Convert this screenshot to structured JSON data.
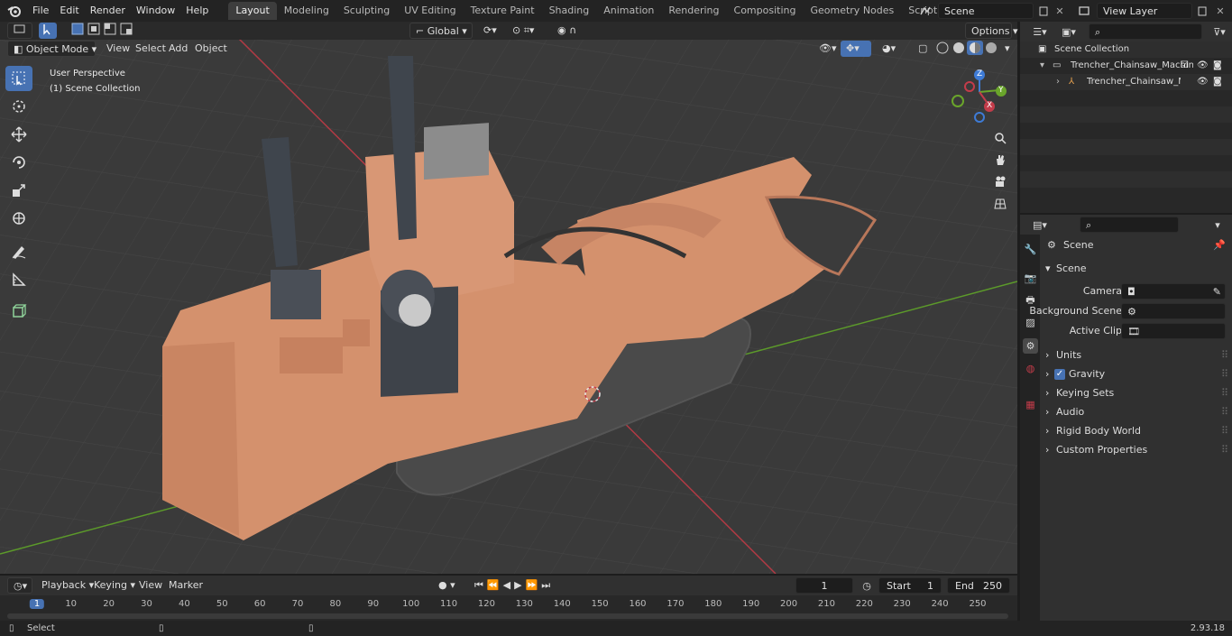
{
  "menu": [
    "File",
    "Edit",
    "Render",
    "Window",
    "Help"
  ],
  "workspaces": [
    "Layout",
    "Modeling",
    "Sculpting",
    "UV Editing",
    "Texture Paint",
    "Shading",
    "Animation",
    "Rendering",
    "Compositing",
    "Geometry Nodes",
    "Scripting"
  ],
  "active_workspace": "Layout",
  "scene_field": "Scene",
  "view_layer_field": "View Layer",
  "viewport": {
    "mode": "Object Mode",
    "menus": [
      "View",
      "Select",
      "Add",
      "Object"
    ],
    "transform_orientation": "Global",
    "options_label": "Options",
    "perspective_label": "User Perspective",
    "collection_label": "(1) Scene Collection"
  },
  "gizmo": {
    "x": "X",
    "y": "Y",
    "z": "Z"
  },
  "outliner": {
    "root": "Scene Collection",
    "items": [
      {
        "label": "Trencher_Chainsaw_Machine_"
      },
      {
        "label": "Trencher_Chainsaw_Mac"
      }
    ]
  },
  "properties": {
    "breadcrumb": "Scene",
    "section": "Scene",
    "fields": [
      {
        "label": "Camera"
      },
      {
        "label": "Background Scene"
      },
      {
        "label": "Active Clip"
      }
    ],
    "panels": [
      "Units",
      "Gravity",
      "Keying Sets",
      "Audio",
      "Rigid Body World",
      "Custom Properties"
    ]
  },
  "timeline": {
    "menus": [
      "Playback",
      "Keying",
      "View",
      "Marker"
    ],
    "current_frame": "1",
    "start_label": "Start",
    "start": "1",
    "end_label": "End",
    "end": "250",
    "ruler": [
      "1",
      "10",
      "20",
      "30",
      "40",
      "50",
      "60",
      "70",
      "80",
      "90",
      "100",
      "110",
      "120",
      "130",
      "140",
      "150",
      "160",
      "170",
      "180",
      "190",
      "200",
      "210",
      "220",
      "230",
      "240",
      "250"
    ]
  },
  "status": {
    "select": "Select",
    "version": "2.93.18"
  },
  "colors": {
    "accent": "#4772b3",
    "machine": "#d4916d",
    "x_axis": "#c33c4a",
    "y_axis": "#6aa52b",
    "z_axis": "#3e7bd6"
  }
}
